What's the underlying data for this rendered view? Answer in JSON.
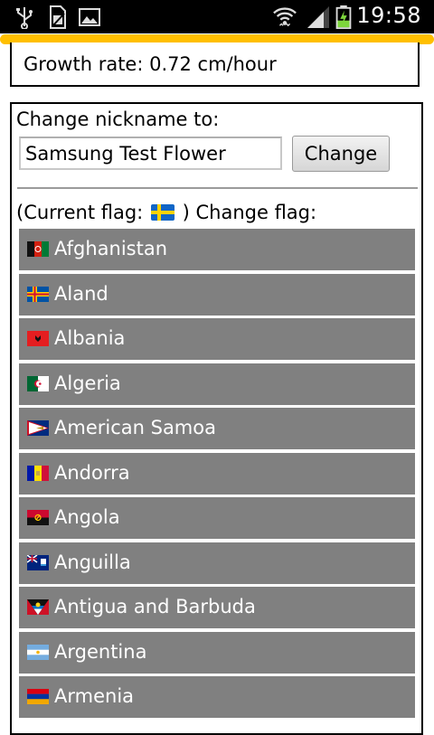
{
  "status_bar": {
    "time": "19:58",
    "icons": [
      "usb-icon",
      "sim-card-icon",
      "image-icon",
      "wifi-icon",
      "signal-icon",
      "battery-charging-icon"
    ]
  },
  "growth": {
    "text": "Growth rate: 0.72 cm/hour"
  },
  "nickname": {
    "label": "Change nickname to:",
    "value": "Samsung Test Flower",
    "button_label": "Change"
  },
  "flag": {
    "prefix": "(Current flag:",
    "suffix": ") Change flag:",
    "current_flag_icon": "sweden-flag-icon"
  },
  "countries": [
    {
      "name": "Afghanistan",
      "flag_icon": "afghanistan-flag-icon"
    },
    {
      "name": "Aland",
      "flag_icon": "aland-flag-icon"
    },
    {
      "name": "Albania",
      "flag_icon": "albania-flag-icon"
    },
    {
      "name": "Algeria",
      "flag_icon": "algeria-flag-icon"
    },
    {
      "name": "American Samoa",
      "flag_icon": "american-samoa-flag-icon"
    },
    {
      "name": "Andorra",
      "flag_icon": "andorra-flag-icon"
    },
    {
      "name": "Angola",
      "flag_icon": "angola-flag-icon"
    },
    {
      "name": "Anguilla",
      "flag_icon": "anguilla-flag-icon"
    },
    {
      "name": "Antigua and Barbuda",
      "flag_icon": "antigua-and-barbuda-flag-icon"
    },
    {
      "name": "Argentina",
      "flag_icon": "argentina-flag-icon"
    },
    {
      "name": "Armenia",
      "flag_icon": "armenia-flag-icon"
    }
  ],
  "colors": {
    "status_bar_bg": "#000000",
    "accent_bar": "#ffbf00",
    "list_item_bg": "#808080",
    "list_item_text": "#ffffff"
  },
  "progress": {
    "accent_bar_fill": 1.0
  }
}
